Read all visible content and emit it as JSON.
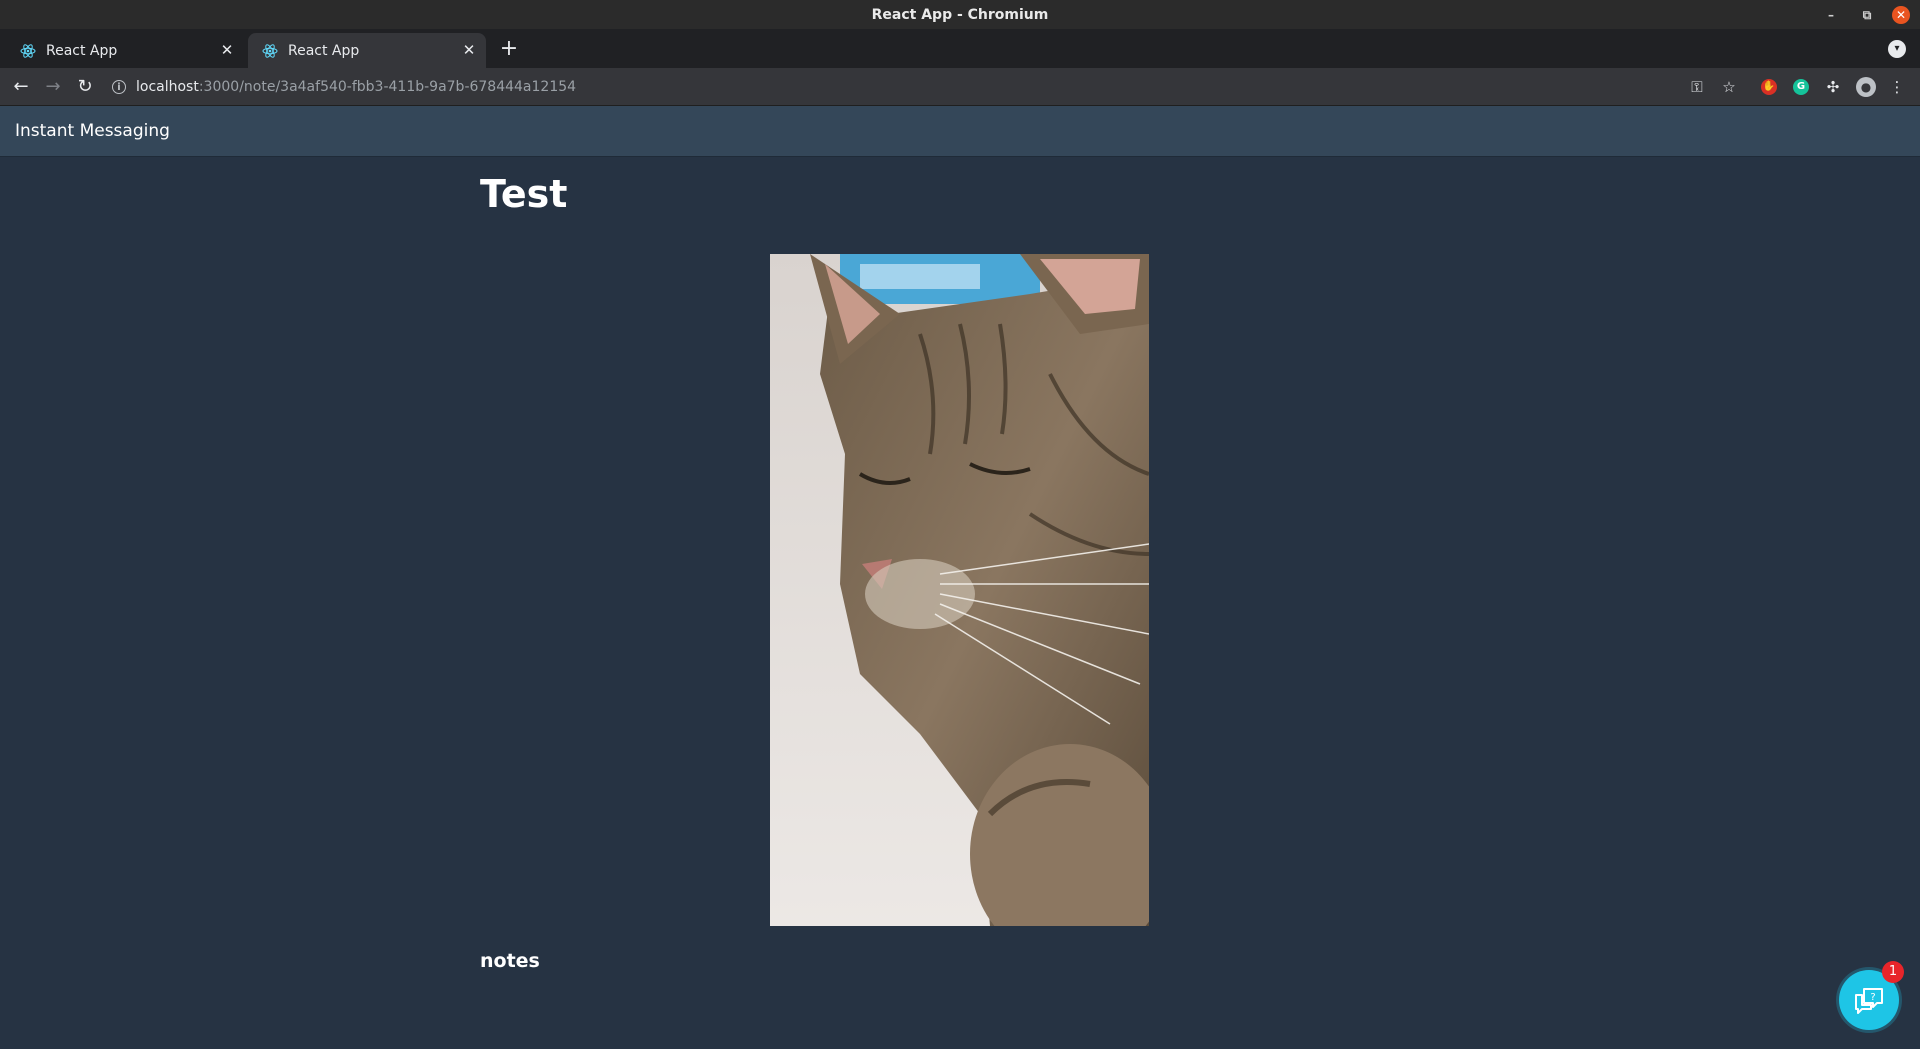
{
  "window": {
    "title": "React App - Chromium",
    "controls": {
      "minimize": "–",
      "restore": "⧉",
      "close": "✕"
    }
  },
  "tabs": [
    {
      "label": "React App",
      "active": false,
      "favicon": "react-logo-icon"
    },
    {
      "label": "React App",
      "active": true,
      "favicon": "react-logo-icon"
    }
  ],
  "toolbar": {
    "url_host": "localhost",
    "url_path": ":3000/note/3a4af540-fbb3-411b-9a7b-678444a12154",
    "icons": [
      "back-icon",
      "forward-icon",
      "reload-icon",
      "info-icon",
      "key-icon",
      "star-icon",
      "extension-red-icon",
      "grammarly-icon",
      "puzzle-icon",
      "profile-icon",
      "menu-icon"
    ]
  },
  "app": {
    "brand": "Instant Messaging"
  },
  "note": {
    "title": "Test",
    "image_description_icon": "cat-photo",
    "notes_label": "notes"
  },
  "chat": {
    "badge_count": "1",
    "accent": "#1ec5e6",
    "badge_color": "#e8252a"
  },
  "colors": {
    "page_bg": "#263343",
    "header_bg": "#344759"
  }
}
